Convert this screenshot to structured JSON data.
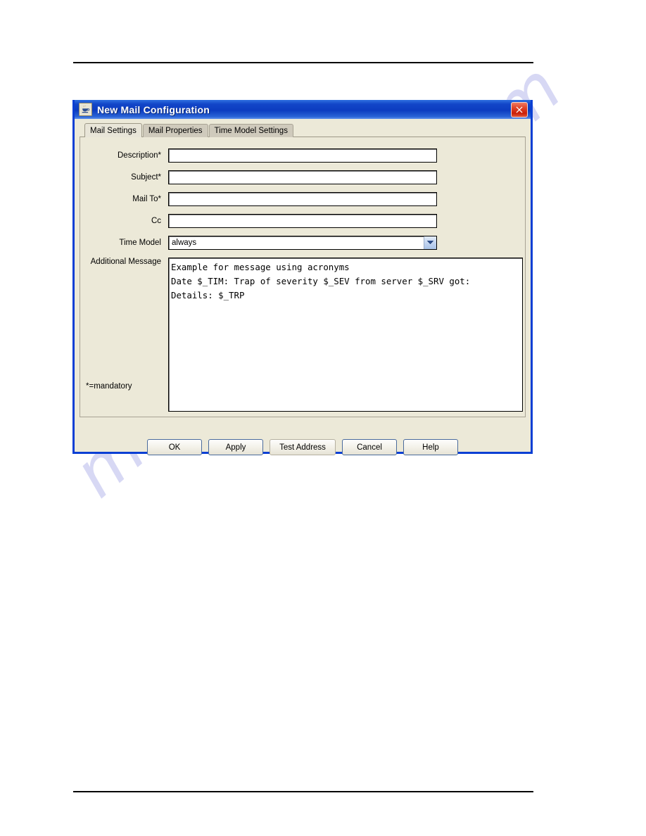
{
  "window": {
    "title": "New Mail Configuration",
    "icon": "java-coffee-cup-icon",
    "close_label": "✕",
    "titlebar_color": "#0c3cc0",
    "border_color": "#0a3fd4",
    "close_color": "#c91f07"
  },
  "tabs": [
    {
      "label": "Mail Settings",
      "active": true
    },
    {
      "label": "Mail Properties",
      "active": false
    },
    {
      "label": "Time Model Settings",
      "active": false
    }
  ],
  "form": {
    "fields": [
      {
        "label": "Description*",
        "value": "",
        "placeholder": "",
        "type": "text"
      },
      {
        "label": "Subject*",
        "value": "",
        "placeholder": "",
        "type": "text"
      },
      {
        "label": "Mail To*",
        "value": "",
        "placeholder": "",
        "type": "text"
      },
      {
        "label": "Cc",
        "value": "",
        "placeholder": "",
        "type": "text"
      }
    ],
    "time_model": {
      "label": "Time Model",
      "value": "always",
      "options": [
        "always"
      ]
    },
    "additional_message": {
      "label": "Additional Message",
      "value": "Example for message using acronyms\nDate $_TIM: Trap of severity $_SEV from server $_SRV got:\nDetails: $_TRP"
    },
    "mandatory_note": "*=mandatory"
  },
  "buttons": [
    {
      "label": "OK",
      "style": "default"
    },
    {
      "label": "Apply",
      "style": "default"
    },
    {
      "label": "Test Address",
      "style": "flat"
    },
    {
      "label": "Cancel",
      "style": "default"
    },
    {
      "label": "Help",
      "style": "default"
    }
  ],
  "watermark": {
    "text": "manualshive.com",
    "color": "#c9caf0"
  }
}
